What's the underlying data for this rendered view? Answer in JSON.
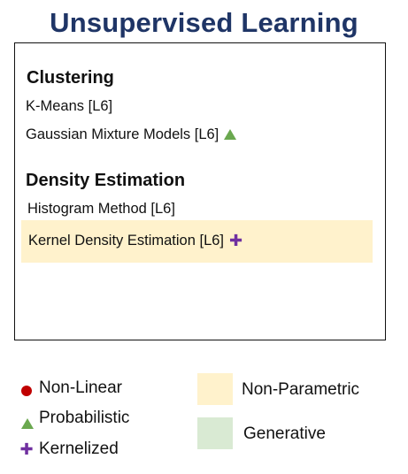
{
  "title": "Unsupervised Learning",
  "panel": {
    "sections": [
      {
        "heading": "Clustering",
        "items": [
          {
            "label": "K-Means [L6]",
            "marker": null
          },
          {
            "label": "Gaussian Mixture Models [L6]",
            "marker": "triangle-icon"
          }
        ]
      },
      {
        "heading": "Density Estimation",
        "items": [
          {
            "label": "Histogram Method [L6]",
            "marker": null
          },
          {
            "label": "Kernel Density Estimation [L6]",
            "marker": "plus-icon",
            "highlight": "non-parametric"
          }
        ]
      }
    ]
  },
  "legend": {
    "markers": [
      {
        "label": "Non-Linear",
        "icon": "circle-icon",
        "color": "#c00000"
      },
      {
        "label": "Probabilistic",
        "icon": "triangle-icon",
        "color": "#6aa84f"
      },
      {
        "label": "Kernelized",
        "icon": "plus-icon",
        "color": "#7030a0"
      }
    ],
    "swatches": [
      {
        "label": "Non-Parametric",
        "color": "#fff2cc"
      },
      {
        "label": "Generative",
        "color": "#d9ead3"
      }
    ]
  },
  "colors": {
    "title": "#1f3566",
    "border": "#111111"
  }
}
